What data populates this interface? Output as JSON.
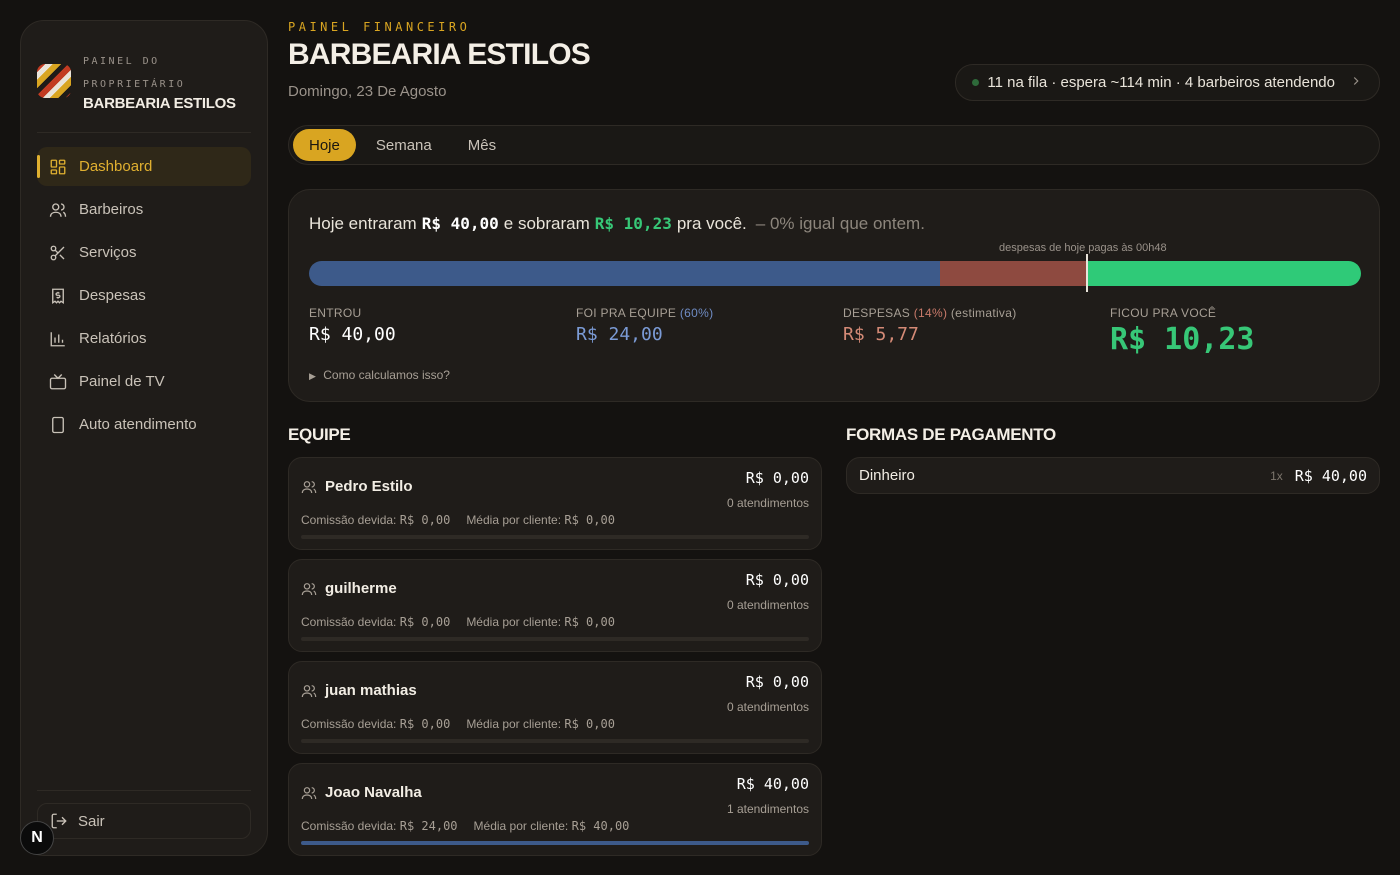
{
  "sidebar": {
    "brand_sub": "PAINEL DO PROPRIETÁRIO",
    "brand_name": "BARBEARIA ESTILOS",
    "items": [
      {
        "label": "Dashboard",
        "icon": "dashboard-icon"
      },
      {
        "label": "Barbeiros",
        "icon": "users-icon"
      },
      {
        "label": "Serviços",
        "icon": "scissors-icon"
      },
      {
        "label": "Despesas",
        "icon": "receipt-icon"
      },
      {
        "label": "Relatórios",
        "icon": "bar-chart-icon"
      },
      {
        "label": "Painel de TV",
        "icon": "tv-icon"
      },
      {
        "label": "Auto atendimento",
        "icon": "tablet-icon"
      }
    ],
    "logout": "Sair"
  },
  "header": {
    "eyebrow": "PAINEL FINANCEIRO",
    "title": "BARBEARIA ESTILOS",
    "date": "Domingo, 23 De Agosto",
    "queue": "11 na fila · espera ~114 min · 4 barbeiros atendendo"
  },
  "tabs": [
    "Hoje",
    "Semana",
    "Mês"
  ],
  "summary": {
    "h_prefix": "Hoje entraram",
    "h_in": "R$ 40,00",
    "h_mid": "e sobraram",
    "h_left": "R$ 10,23",
    "h_suffix": "pra você.",
    "h_compare": "– 0% igual que ontem.",
    "bar_note": "despesas de hoje pagas às 00h48",
    "bar_shares": {
      "team": 0.6,
      "expenses": 0.14,
      "owner": 0.26
    },
    "entrou_label": "ENTROU",
    "entrou_value": "R$ 40,00",
    "equipe_label": "FOI PRA EQUIPE",
    "equipe_pct": "(60%)",
    "equipe_value": "R$ 24,00",
    "despesas_label": "DESPESAS",
    "despesas_pct": "(14%)",
    "despesas_note": "(estimativa)",
    "despesas_value": "R$ 5,77",
    "ficou_label": "FICOU PRA VOCÊ",
    "ficou_value": "R$ 10,23",
    "howcalc": "Como calculamos isso?"
  },
  "team": {
    "title": "EQUIPE",
    "commission_label": "Comissão devida:",
    "avg_label": "Média por cliente:",
    "barbers": [
      {
        "name": "Pedro Estilo",
        "total": "R$ 0,00",
        "count": "0 atendimentos",
        "commission": "R$ 0,00",
        "avg": "R$ 0,00",
        "share": 0
      },
      {
        "name": "guilherme",
        "total": "R$ 0,00",
        "count": "0 atendimentos",
        "commission": "R$ 0,00",
        "avg": "R$ 0,00",
        "share": 0
      },
      {
        "name": "juan mathias",
        "total": "R$ 0,00",
        "count": "0 atendimentos",
        "commission": "R$ 0,00",
        "avg": "R$ 0,00",
        "share": 0
      },
      {
        "name": "Joao Navalha",
        "total": "R$ 40,00",
        "count": "1 atendimentos",
        "commission": "R$ 24,00",
        "avg": "R$ 40,00",
        "share": 1
      }
    ]
  },
  "payments": {
    "title": "FORMAS DE PAGAMENTO",
    "items": [
      {
        "name": "Dinheiro",
        "qty": "1x",
        "value": "R$ 40,00"
      }
    ]
  },
  "colors": {
    "accent": "#d9a521",
    "team_blue": "#3d5a8a",
    "expense_red": "#8e4a40",
    "profit_green": "#2fca78"
  }
}
